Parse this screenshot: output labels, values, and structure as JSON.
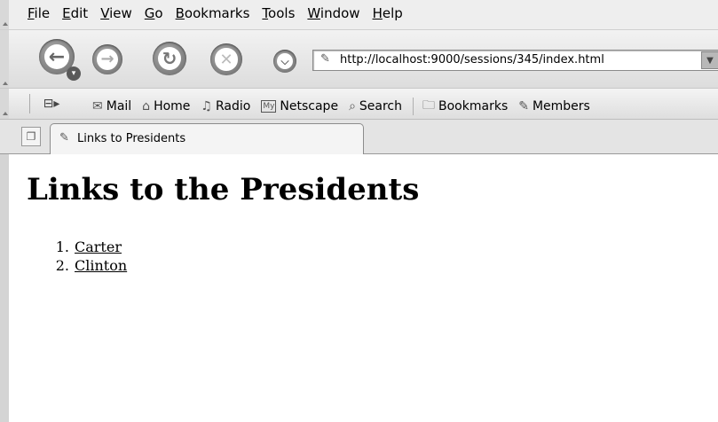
{
  "menubar": {
    "items": [
      {
        "mnemonic": "F",
        "rest": "ile"
      },
      {
        "mnemonic": "E",
        "rest": "dit"
      },
      {
        "mnemonic": "V",
        "rest": "iew"
      },
      {
        "mnemonic": "G",
        "rest": "o"
      },
      {
        "mnemonic": "B",
        "rest": "ookmarks"
      },
      {
        "mnemonic": "T",
        "rest": "ools"
      },
      {
        "mnemonic": "W",
        "rest": "indow"
      },
      {
        "mnemonic": "H",
        "rest": "elp"
      }
    ]
  },
  "navbar": {
    "url": "http://localhost:9000/sessions/345/index.html"
  },
  "personal_toolbar": {
    "items": [
      {
        "icon": "mail-icon",
        "label": "Mail"
      },
      {
        "icon": "home-icon",
        "label": "Home"
      },
      {
        "icon": "radio-icon",
        "label": "Radio"
      },
      {
        "icon": "my-netscape-icon",
        "icon_text": "My",
        "label": "Netscape"
      },
      {
        "icon": "search-icon",
        "label": "Search"
      },
      {
        "icon": "bookmarks-folder-icon",
        "label": "Bookmarks"
      },
      {
        "icon": "bookmark-icon",
        "label": "Members"
      }
    ]
  },
  "tab": {
    "title": "Links to Presidents"
  },
  "page": {
    "heading": "Links to the Presidents",
    "links": [
      {
        "number": "1.",
        "text": "Carter"
      },
      {
        "number": "2.",
        "text": "Clinton"
      }
    ]
  }
}
